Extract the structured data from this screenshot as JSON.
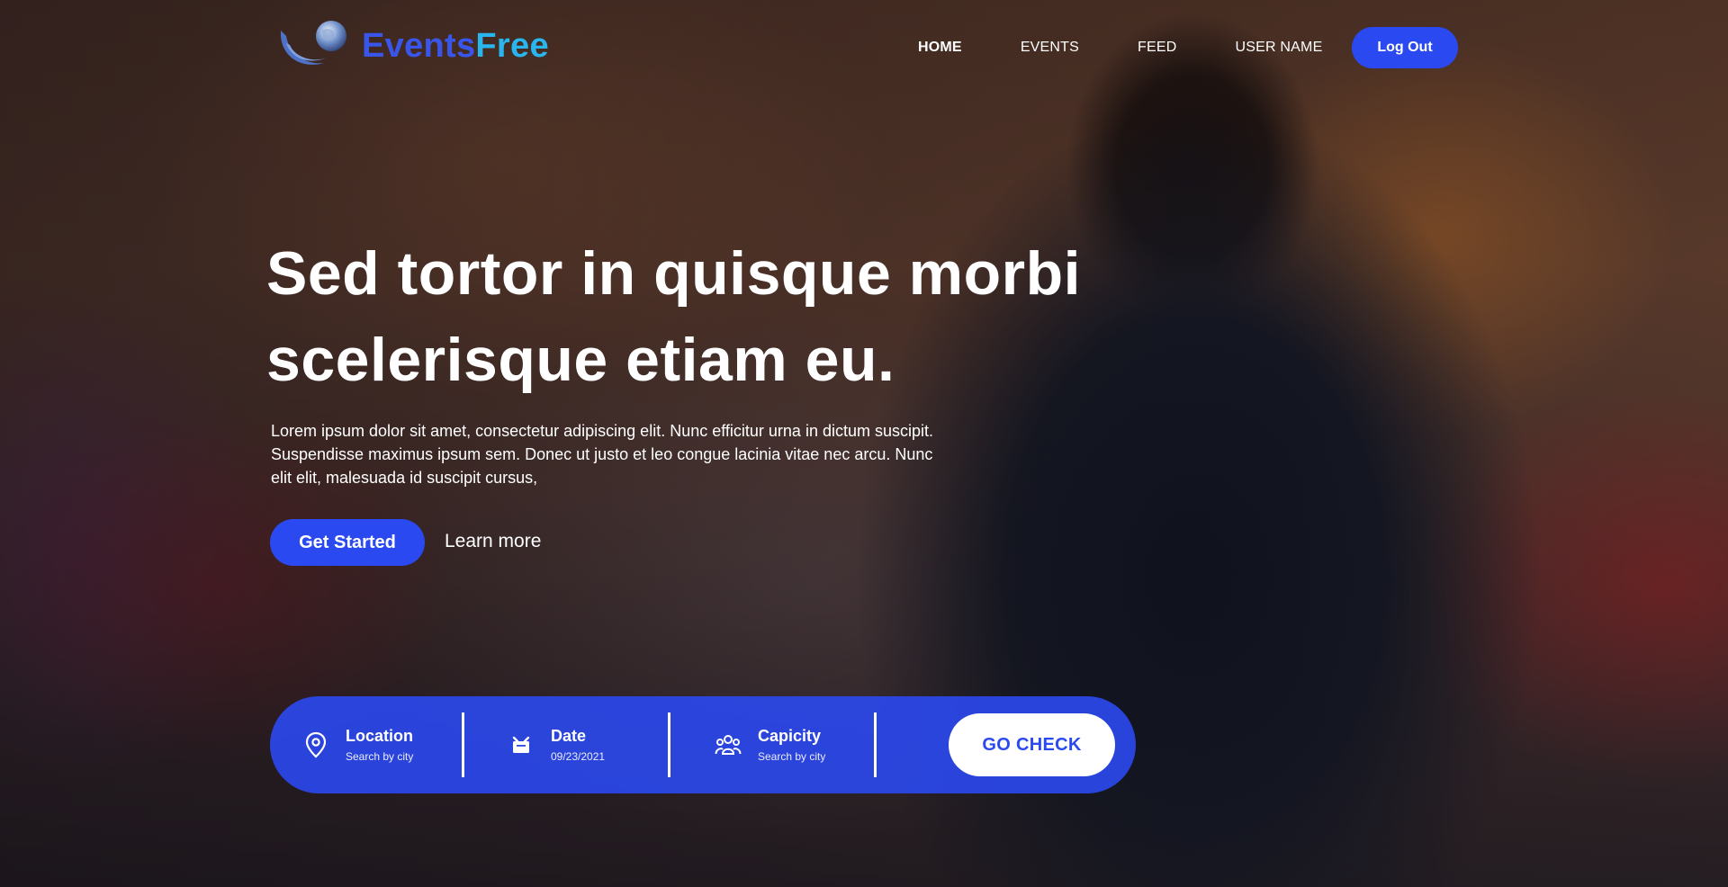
{
  "brand": {
    "name_part1": "Events",
    "name_part2": "Free"
  },
  "nav": {
    "items": [
      {
        "label": "HOME",
        "active": true
      },
      {
        "label": "EVENTS",
        "active": false
      },
      {
        "label": "FEED",
        "active": false
      },
      {
        "label": "USER NAME",
        "active": false
      }
    ],
    "logout_label": "Log Out"
  },
  "hero": {
    "title_line1": "Sed tortor in quisque morbi",
    "title_line2": "scelerisque etiam eu.",
    "text": "Lorem ipsum dolor sit amet, consectetur adipiscing elit. Nunc efficitur urna in dictum suscipit. Suspendisse maximus ipsum sem. Donec ut justo et leo congue lacinia vitae nec arcu. Nunc elit elit, malesuada id suscipit cursus,",
    "primary_button": "Get Started",
    "secondary_button": "Learn more"
  },
  "search": {
    "location": {
      "label": "Location",
      "sub": "Search by city",
      "icon": "location-pin-icon"
    },
    "date": {
      "label": "Date",
      "sub": "09/23/2021",
      "icon": "calendar-icon"
    },
    "capacity": {
      "label": "Capicity",
      "sub": "Search by city",
      "icon": "people-group-icon"
    },
    "submit_label": "GO CHECK"
  },
  "colors": {
    "accent": "#2b49f0",
    "brand_dark": "#3a55ea",
    "brand_light": "#29b6ee"
  }
}
